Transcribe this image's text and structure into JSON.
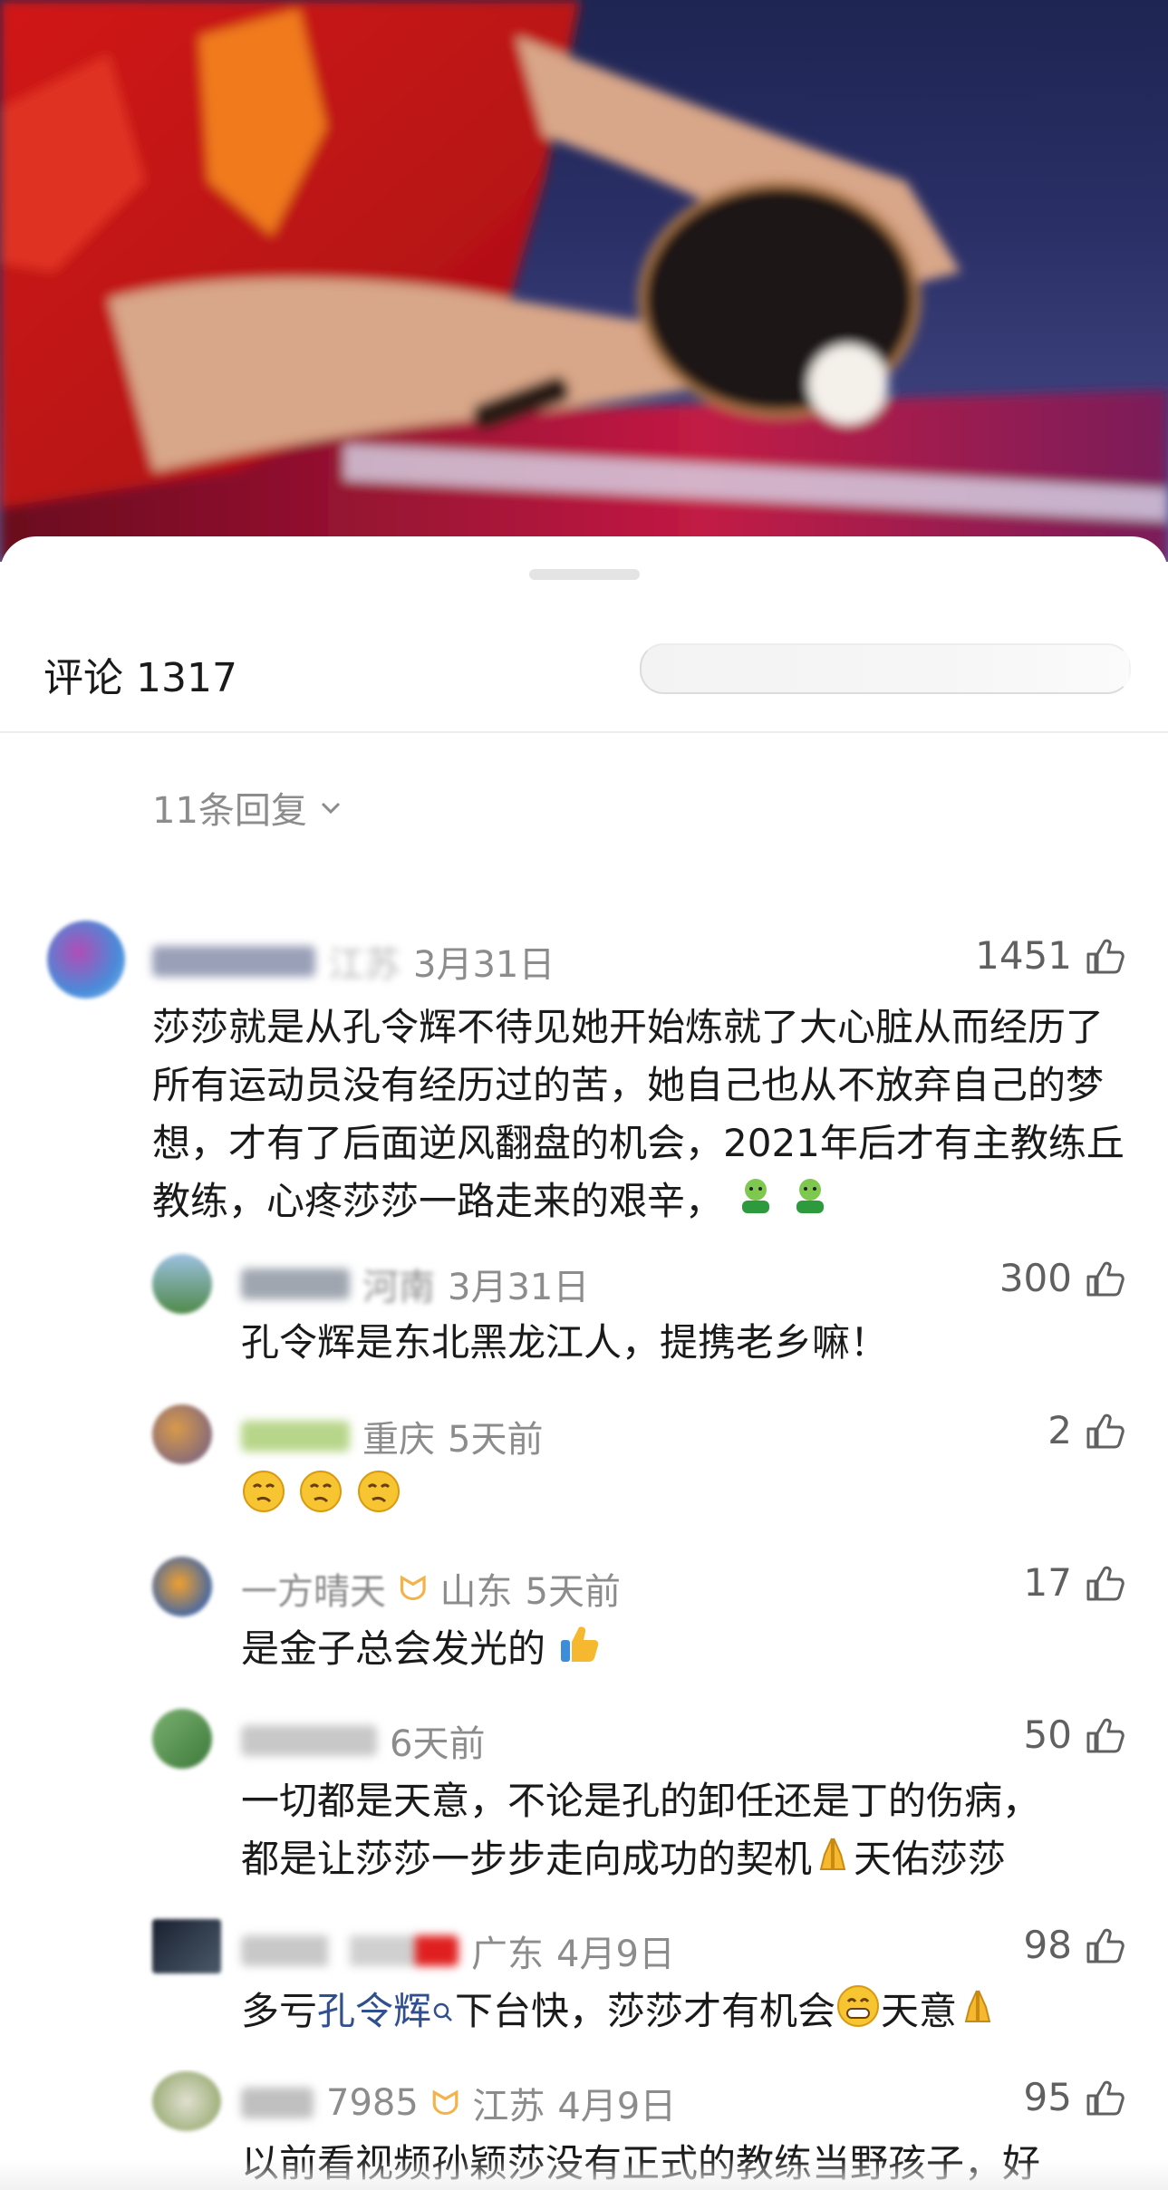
{
  "header": {
    "title": "评论 1317",
    "search_placeholder": ""
  },
  "thread": {
    "replies_toggle": "11条回复"
  },
  "comments": [
    {
      "location": "江苏",
      "time": "3月31日",
      "likes": "1451",
      "text": "莎莎就是从孔令辉不待见她开始炼就了大心脏从而经历了所有运动员没有经历过的苦，她自己也从不放弃自己的梦想，才有了后面逆风翻盘的机会，2021年后才有主教练丘教练，心疼莎莎一路走来的艰辛，",
      "emojis": [
        "shrug-emoji",
        "shrug-emoji"
      ]
    },
    {
      "location": "河南",
      "time": "3月31日",
      "likes": "300",
      "text": "孔令辉是东北黑龙江人，提携老乡嘛！"
    },
    {
      "location": "重庆",
      "time": "5天前",
      "likes": "2",
      "text": "",
      "emojis": [
        "thinking-emoji",
        "thinking-emoji",
        "thinking-emoji"
      ]
    },
    {
      "name": "一方晴天",
      "location": "山东",
      "time": "5天前",
      "likes": "17",
      "text": "是金子总会发光的"
    },
    {
      "time": "6天前",
      "likes": "50",
      "text_lines": [
        "一切都是天意，不论是孔的卸任还是丁的伤病，",
        "都是让莎莎一步步走向成功的契机",
        "天佑莎莎"
      ]
    },
    {
      "location": "广东",
      "time": "4月9日",
      "likes": "98",
      "text_before": "多亏",
      "link": "孔令辉",
      "text_mid": "下台快，莎莎才有机会",
      "text_after": "天意"
    },
    {
      "name": "7985",
      "location": "江苏",
      "time": "4月9日",
      "likes": "95",
      "text": "以前看视频孙颖莎没有正式的教练当野孩子，好"
    }
  ],
  "colors": {
    "meta": "#8c8c8c",
    "link": "#2f4f8f",
    "badge": "#f2b34a"
  },
  "icons": [
    "thumb-up-icon",
    "chevron-down-icon",
    "search-icon",
    "badge-icon",
    "link-search-icon"
  ]
}
